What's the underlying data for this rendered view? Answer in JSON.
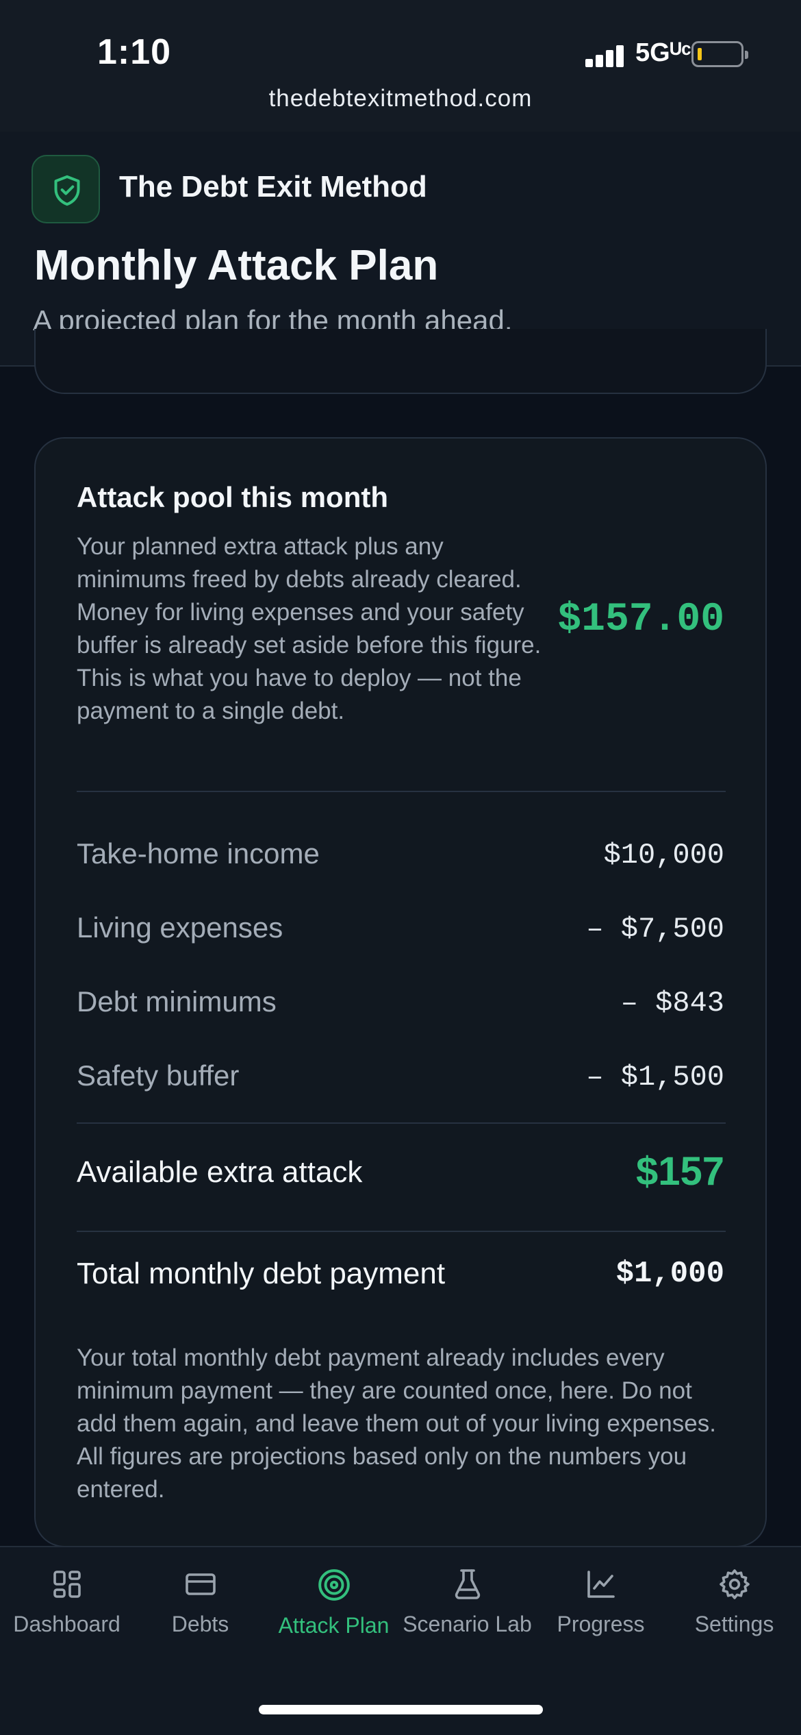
{
  "status_bar": {
    "time": "1:10",
    "network": "5Gᵁᶜ",
    "url": "thedebtexitmethod.com"
  },
  "header": {
    "brand": "The Debt Exit Method",
    "logo_icon": "shield-check-icon",
    "title": "Monthly Attack Plan",
    "subtitle": "A projected plan for the month ahead."
  },
  "attack_pool": {
    "title": "Attack pool this month",
    "description": "Your planned extra attack plus any minimums freed by debts already cleared. Money for living expenses and your safety buffer is already set aside before this figure. This is what you have to deploy — not the payment to a single debt.",
    "amount": "$157.00",
    "rows": [
      {
        "label": "Take-home income",
        "value": "$10,000"
      },
      {
        "label": "Living expenses",
        "value": "– $7,500"
      },
      {
        "label": "Debt minimums",
        "value": "– $843"
      },
      {
        "label": "Safety buffer",
        "value": "– $1,500"
      }
    ],
    "available_label": "Available extra attack",
    "available_value": "$157",
    "total_label": "Total monthly debt payment",
    "total_value": "$1,000",
    "note": "Your total monthly debt payment already includes every minimum payment — they are counted once, here. Do not add them again, and leave them out of your living expenses. All figures are projections based only on the numbers you entered."
  },
  "bottom_nav": {
    "items": [
      {
        "label": "Dashboard",
        "icon": "dashboard-icon"
      },
      {
        "label": "Debts",
        "icon": "credit-card-icon"
      },
      {
        "label": "Attack Plan",
        "icon": "target-icon",
        "active": true
      },
      {
        "label": "Scenario Lab",
        "icon": "flask-icon"
      },
      {
        "label": "Progress",
        "icon": "chart-line-icon"
      },
      {
        "label": "Settings",
        "icon": "gear-icon"
      }
    ]
  },
  "colors": {
    "accent": "#33c07d",
    "background": "#0b111b",
    "card": "#111820"
  }
}
